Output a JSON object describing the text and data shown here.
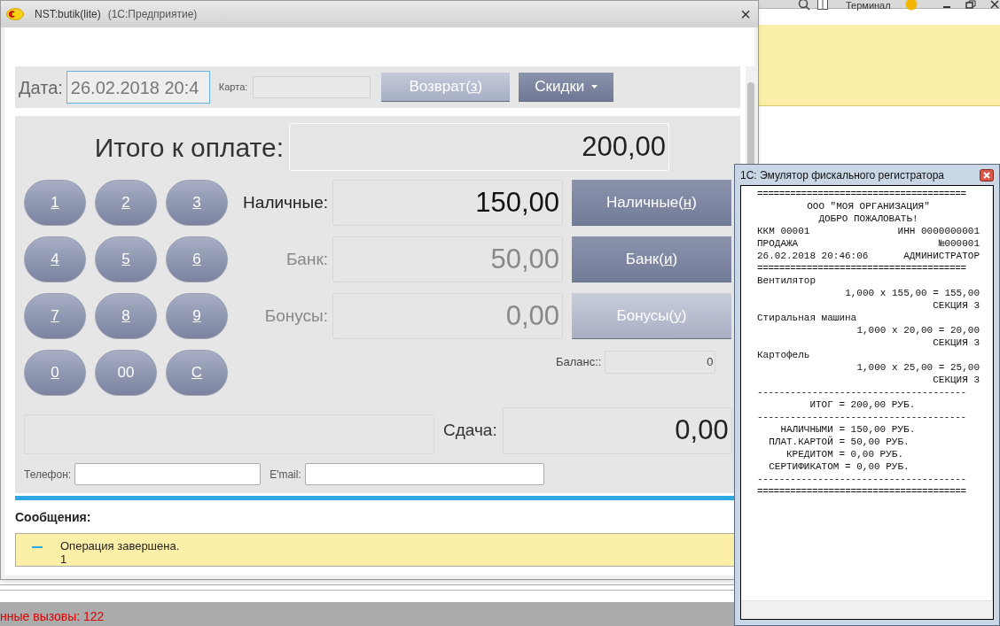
{
  "background_app": {
    "toolbar_label": "Терминал",
    "status_text": "нные вызовы: 122"
  },
  "window": {
    "title": "NST:butik(lite)",
    "subtitle": "(1С:Предприятие)",
    "close": "×"
  },
  "header": {
    "date_label": "Дата:",
    "date_value": "26.02.2018 20:4",
    "card_label": "Карта:",
    "buttons": [
      {
        "kind": "return",
        "before": "Возврат(",
        "hotkey": "з",
        "after": ")"
      },
      {
        "kind": "discounts",
        "before": "Скидки"
      }
    ]
  },
  "total": {
    "label": "Итого к оплате:",
    "value": "200,00"
  },
  "keypad": [
    {
      "label": "1",
      "underlined": true
    },
    {
      "label": "2",
      "underlined": true
    },
    {
      "label": "3",
      "underlined": true
    },
    {
      "label": "4",
      "underlined": true
    },
    {
      "label": "5",
      "underlined": true
    },
    {
      "label": "6",
      "underlined": true
    },
    {
      "label": "7",
      "underlined": true
    },
    {
      "label": "8",
      "underlined": true
    },
    {
      "label": "9",
      "underlined": true
    },
    {
      "label": "0",
      "underlined": true
    },
    {
      "label": "00",
      "underlined": false
    },
    {
      "label": "С",
      "underlined": true
    }
  ],
  "payments": [
    {
      "label": "Наличные:",
      "value": "150,00",
      "active": true,
      "button": {
        "before": "Наличные(",
        "hotkey": "н",
        "after": ")"
      }
    },
    {
      "label": "Банк:",
      "value": "50,00",
      "active": false,
      "button": {
        "before": "Банк(",
        "hotkey": "и",
        "after": ")"
      }
    },
    {
      "label": "Бонусы:",
      "value": "0,00",
      "active": false,
      "disabled": true,
      "button": {
        "before": "Бонусы(",
        "hotkey": "у",
        "after": ")"
      }
    }
  ],
  "balance": {
    "label": "Баланс::",
    "value": "0"
  },
  "change": {
    "label": "Сдача:",
    "value": "0,00"
  },
  "contacts": [
    {
      "label": "Телефон:"
    },
    {
      "label": "E'mail:"
    }
  ],
  "messages": {
    "title": "Сообщения:",
    "items": [
      {
        "text": "Операция завершена.",
        "line2": "1"
      }
    ]
  },
  "fiscal": {
    "title": "1С: Эмулятор фискального регистратора",
    "lines": [
      {
        "kind": "rule",
        "text": "======================================"
      },
      {
        "kind": "center",
        "text": "ООО \"МОЯ ОРГАНИЗАЦИЯ\""
      },
      {
        "kind": "center",
        "text": "ДОБРО ПОЖАЛОВАТЬ!"
      },
      {
        "kind": "pair",
        "left": "ККМ 00001",
        "right": "ИНН 0000000001"
      },
      {
        "kind": "pair",
        "left": "ПРОДАЖА",
        "right": "№000001"
      },
      {
        "kind": "pair",
        "left": "26.02.2018 20:46:06",
        "right": "АДМИНИСТРАТОР"
      },
      {
        "kind": "rule",
        "text": "======================================"
      },
      {
        "kind": "left",
        "text": "Вентилятор"
      },
      {
        "kind": "right",
        "text": "1,000 x 155,00 = 155,00"
      },
      {
        "kind": "right",
        "text": "СЕКЦИЯ 3"
      },
      {
        "kind": "left",
        "text": "Стиральная машина"
      },
      {
        "kind": "right",
        "text": "1,000 x 20,00 = 20,00"
      },
      {
        "kind": "right",
        "text": "СЕКЦИЯ 3"
      },
      {
        "kind": "left",
        "text": "Картофель"
      },
      {
        "kind": "right",
        "text": "1,000 x 25,00 = 25,00"
      },
      {
        "kind": "right",
        "text": "СЕКЦИЯ 3"
      },
      {
        "kind": "rule",
        "text": "--------------------------------------"
      },
      {
        "kind": "pre",
        "text": "         ИТОГ = 200,00 РУБ."
      },
      {
        "kind": "rule",
        "text": "--------------------------------------"
      },
      {
        "kind": "pre",
        "text": "    НАЛИЧНЫМИ = 150,00 РУБ."
      },
      {
        "kind": "pre",
        "text": "  ПЛАТ.КАРТОЙ = 50,00 РУБ."
      },
      {
        "kind": "pre",
        "text": "     КРЕДИТОМ = 0,00 РУБ."
      },
      {
        "kind": "pre",
        "text": "  СЕРТИФИКАТОМ = 0,00 РУБ."
      },
      {
        "kind": "rule",
        "text": "--------------------------------------"
      },
      {
        "kind": "rule",
        "text": "======================================"
      }
    ]
  }
}
